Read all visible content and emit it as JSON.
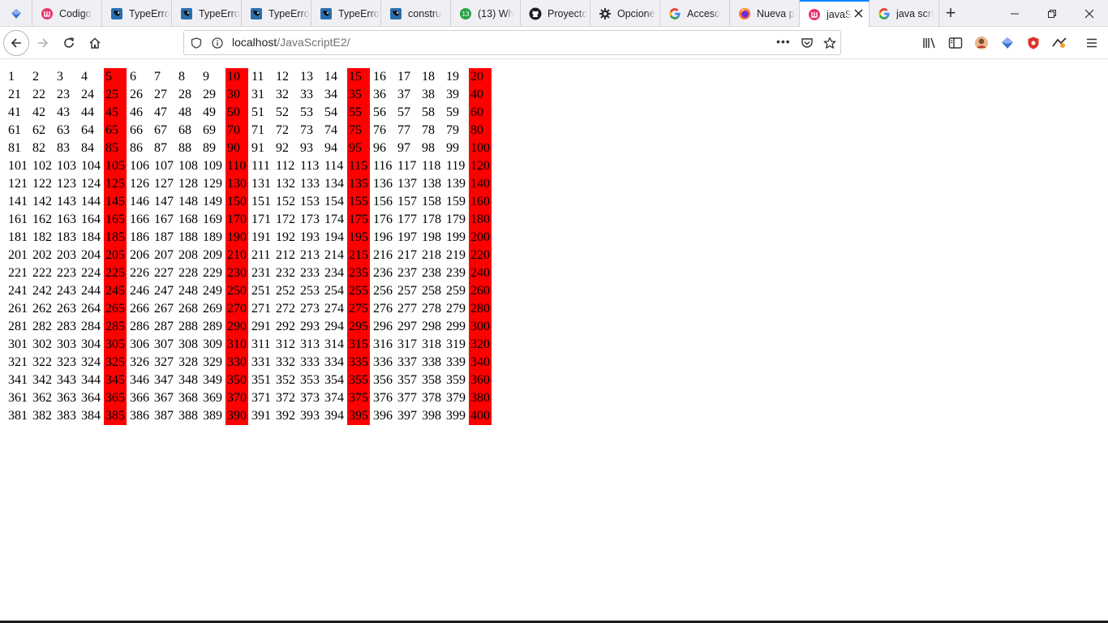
{
  "browser": {
    "pinned_tab": {
      "icon": "extension-shield-icon"
    },
    "tabs": [
      {
        "label": "Codigo",
        "icon": "livecode-icon",
        "active": false
      },
      {
        "label": "TypeErro",
        "icon": "stack-icon",
        "active": false
      },
      {
        "label": "TypeErro",
        "icon": "stack-icon",
        "active": false
      },
      {
        "label": "TypeErro",
        "icon": "stack-icon",
        "active": false
      },
      {
        "label": "TypeErro",
        "icon": "stack-icon",
        "active": false
      },
      {
        "label": "constru",
        "icon": "stack-icon",
        "active": false
      },
      {
        "label": "(13) Wh",
        "icon": "whatsapp-icon",
        "active": false
      },
      {
        "label": "Proyecto",
        "icon": "github-icon",
        "active": false
      },
      {
        "label": "Opcione",
        "icon": "gear-icon",
        "active": false
      },
      {
        "label": "Acceso",
        "icon": "google-icon",
        "active": false
      },
      {
        "label": "Nueva p",
        "icon": "firefox-icon",
        "active": false
      },
      {
        "label": "javaS",
        "icon": "livecode-icon",
        "active": true
      },
      {
        "label": "java scri",
        "icon": "google-icon",
        "active": false
      }
    ],
    "new_tab_label": "+",
    "window_controls": {
      "minimize": "—",
      "restore": "❐",
      "close": "✕"
    },
    "url": {
      "host": "localhost",
      "path": "/JavaScriptE2/"
    },
    "page_actions_label": "•••"
  },
  "page": {
    "columns": 20,
    "highlight_color": "#ff0000",
    "numbers_start": 1,
    "numbers_end": 400,
    "highlight_every": 5
  }
}
